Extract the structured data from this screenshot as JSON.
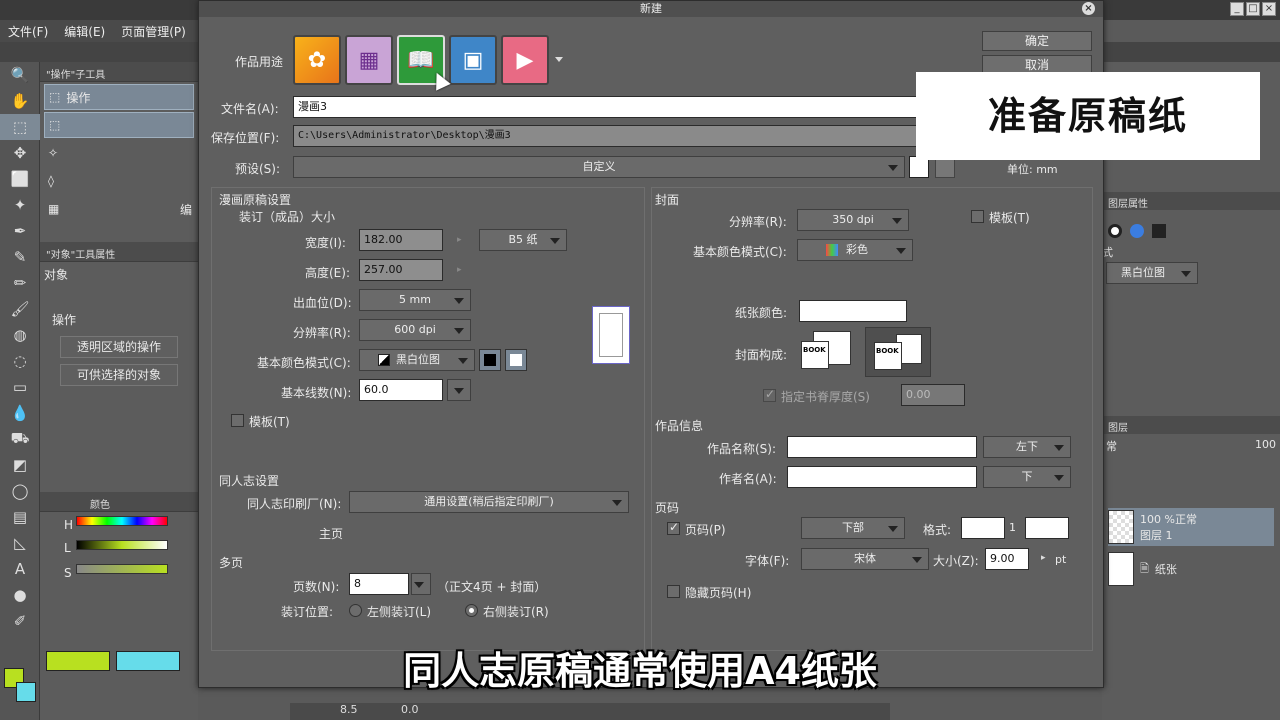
{
  "app": {
    "menu": [
      "文件(F)",
      "编辑(E)",
      "页面管理(P)"
    ],
    "window_controls": [
      "_",
      "□",
      "×"
    ]
  },
  "left_panel": {
    "tool_tab": "\"操作\"子工具",
    "subtools": [
      "操作",
      "",
      "",
      "",
      ""
    ],
    "subtool_extra": "编",
    "property_tab": "\"对象\"工具属性",
    "object_label": "对象",
    "operation_label": "操作",
    "op_buttons": [
      "透明区域的操作",
      "可供选择的对象"
    ],
    "color_tab": "颜色",
    "channels": [
      "H",
      "L",
      "S"
    ],
    "colors": {
      "main": "#b8e020",
      "sub": "#66dcea",
      "accent": "#7d8a96"
    }
  },
  "right_panel": {
    "tab_layer_props": "图层属性",
    "mode_label": "式",
    "mode_value": "黑白位图",
    "layers_tab": "图层",
    "blend": "常",
    "opacity": "100",
    "layers": [
      {
        "name": "100 %正常",
        "sub": "图层 1"
      },
      {
        "name": "纸张",
        "sub": ""
      }
    ]
  },
  "bottom_bar": {
    "zoom": "8.5",
    "angle": "0.0"
  },
  "dialog": {
    "title": "新建",
    "close": "×",
    "ok": "确定",
    "cancel": "取消",
    "purpose_label": "作品用途",
    "purpose_icons": [
      "illustration-icon",
      "webtoon-icon",
      "comic-icon",
      "print-icon",
      "animation-icon"
    ],
    "filename_label": "文件名(A):",
    "filename": "漫画3",
    "save_label": "保存位置(F):",
    "save_path": "C:\\Users\\Administrator\\Desktop\\漫画3",
    "preset_label": "预设(S):",
    "preset": "自定义",
    "unit": "单位: mm",
    "manuscript": {
      "title": "漫画原稿设置",
      "binding_size": "装订（成品）大小",
      "width_label": "宽度(I):",
      "width": "182.00",
      "paper": "B5 纸",
      "height_label": "高度(E):",
      "height": "257.00",
      "bleed_label": "出血位(D):",
      "bleed": "5 mm",
      "res_label": "分辨率(R):",
      "res": "600 dpi",
      "color_label": "基本颜色模式(C):",
      "color": "黑白位图",
      "lines_label": "基本线数(N):",
      "lines": "60.0",
      "template": "模板(T)"
    },
    "doujin": {
      "title": "同人志设置",
      "printer_label": "同人志印刷厂(N):",
      "printer": "通用设置(稍后指定印刷厂)",
      "main_page": "主页"
    },
    "multi": {
      "title": "多页",
      "pages_label": "页数(N):",
      "pages": "8",
      "pages_note": "（正文4页 + 封面）",
      "binding_label": "装订位置:",
      "left": "左侧装订(L)",
      "right": "右侧装订(R)"
    },
    "cover": {
      "title": "封面",
      "res_label": "分辨率(R):",
      "res": "350 dpi",
      "template": "模板(T)",
      "color_label": "基本颜色模式(C):",
      "color": "彩色",
      "paper_label": "纸张颜色:",
      "structure_label": "封面构成:",
      "book": "BOOK",
      "spine_label": "指定书脊厚度(S)",
      "spine": "0.00"
    },
    "work_info": {
      "title": "作品信息",
      "name_label": "作品名称(S):",
      "name_pos": "左下",
      "author_label": "作者名(A):",
      "author_pos": "下"
    },
    "page_num": {
      "title": "页码",
      "enable": "页码(P)",
      "pos": "下部",
      "format_label": "格式:",
      "format_mid": "1",
      "font_label": "字体(F):",
      "font": "宋体",
      "size_label": "大小(Z):",
      "size": "9.00",
      "unit": "pt",
      "hide": "隐藏页码(H)"
    }
  },
  "overlay": {
    "callout": "准备原稿纸",
    "subtitle": "同人志原稿通常使用A4纸张"
  }
}
